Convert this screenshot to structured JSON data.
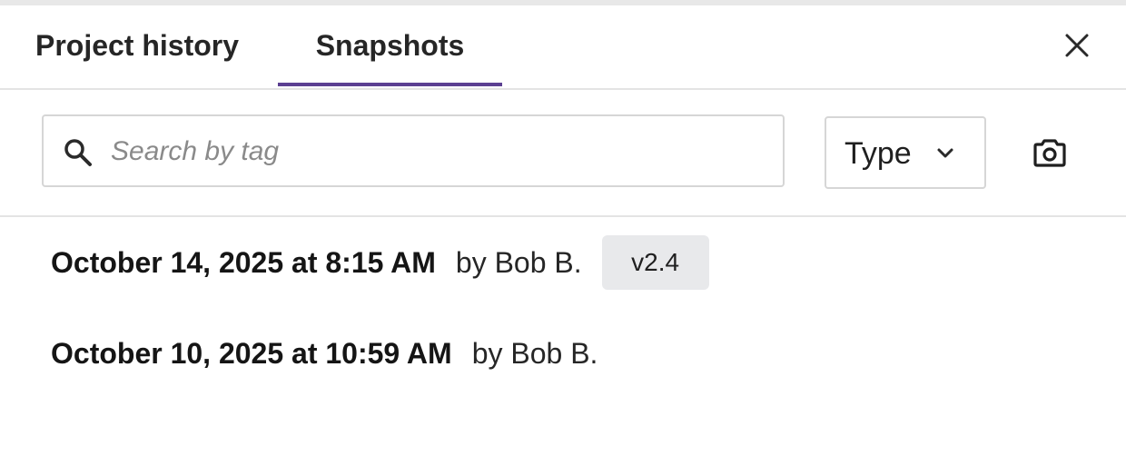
{
  "tabs": {
    "history_label": "Project history",
    "snapshots_label": "Snapshots",
    "active": "Snapshots"
  },
  "accent_color": "#5b3f91",
  "search": {
    "placeholder": "Search by tag",
    "value": ""
  },
  "filter": {
    "label": "Type"
  },
  "icons": {
    "close": "close-icon",
    "search": "search-icon",
    "chevron": "chevron-down-icon",
    "camera": "camera-icon"
  },
  "snapshots": [
    {
      "date": "October 14, 2025 at 8:15 AM",
      "author": "by Bob B.",
      "tag": "v2.4"
    },
    {
      "date": "October 10, 2025 at 10:59 AM",
      "author": "by Bob B.",
      "tag": ""
    }
  ]
}
